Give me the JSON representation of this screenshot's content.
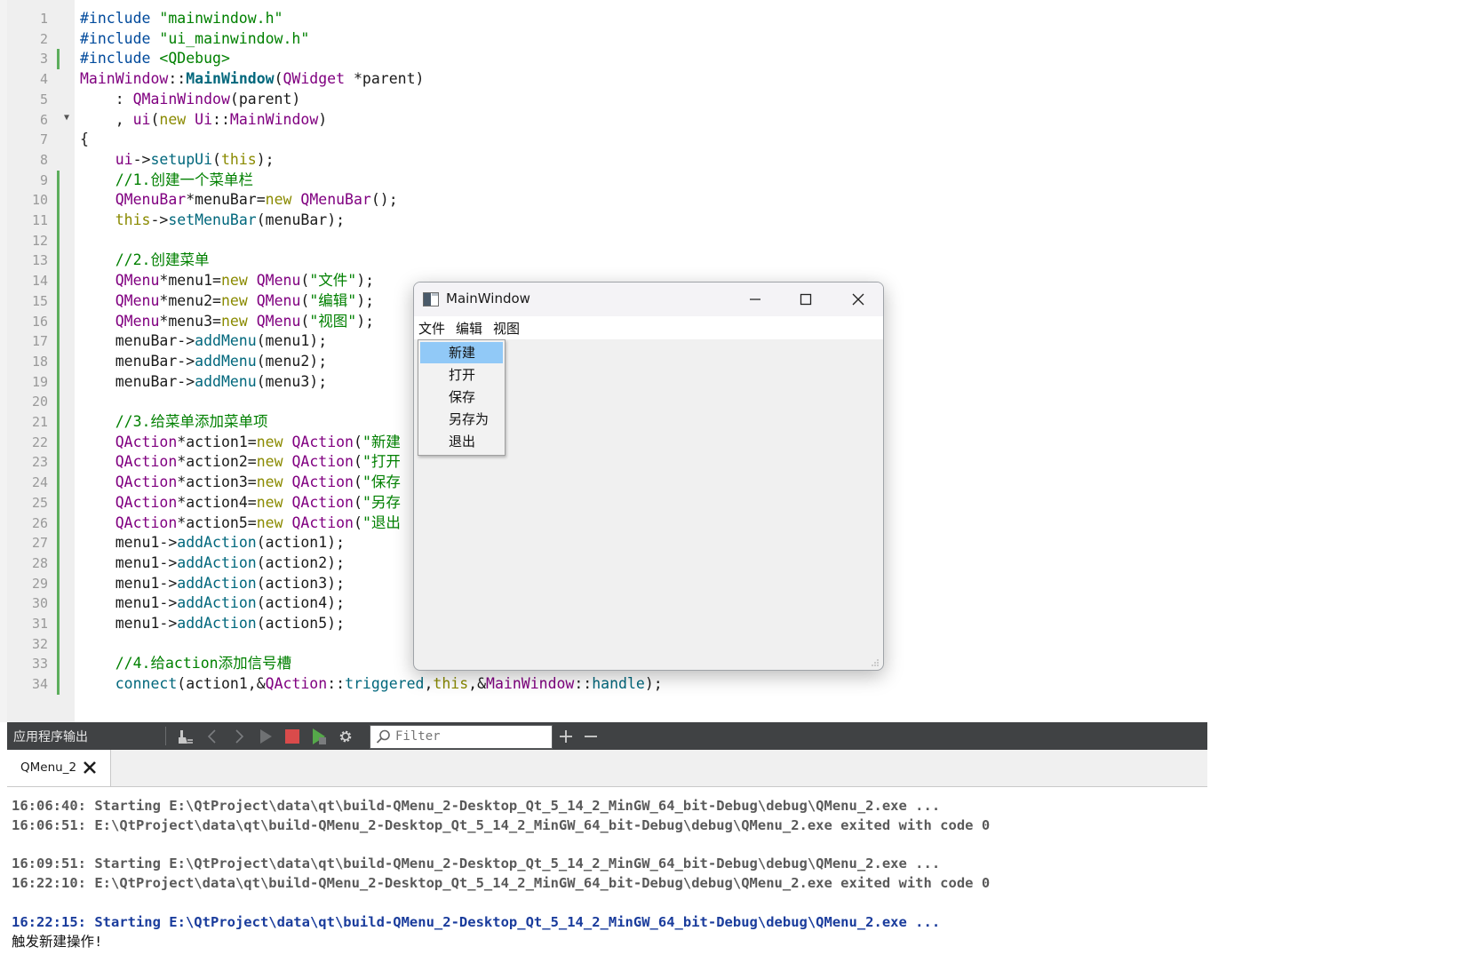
{
  "editor": {
    "line_numbers": [
      "1",
      "2",
      "3",
      "4",
      "5",
      "6",
      "7",
      "8",
      "9",
      "10",
      "11",
      "12",
      "13",
      "14",
      "15",
      "16",
      "17",
      "18",
      "19",
      "20",
      "21",
      "22",
      "23",
      "24",
      "25",
      "26",
      "27",
      "28",
      "29",
      "30",
      "31",
      "32",
      "33",
      "34"
    ],
    "lines": [
      [
        {
          "c": "pp",
          "t": "#include "
        },
        {
          "c": "str",
          "t": "\"mainwindow.h\""
        }
      ],
      [
        {
          "c": "pp",
          "t": "#include "
        },
        {
          "c": "str",
          "t": "\"ui_mainwindow.h\""
        }
      ],
      [
        {
          "c": "pp",
          "t": "#include "
        },
        {
          "c": "str",
          "t": "<QDebug>"
        }
      ],
      [
        {
          "c": "ty",
          "t": "MainWindow"
        },
        {
          "c": "pl",
          "t": "::"
        },
        {
          "c": "fnb",
          "t": "MainWindow"
        },
        {
          "c": "pl",
          "t": "("
        },
        {
          "c": "ty",
          "t": "QWidget"
        },
        {
          "c": "pl",
          "t": " *parent)"
        }
      ],
      [
        {
          "c": "pl",
          "t": "    : "
        },
        {
          "c": "ty",
          "t": "QMainWindow"
        },
        {
          "c": "pl",
          "t": "(parent)"
        }
      ],
      [
        {
          "c": "pl",
          "t": "    , "
        },
        {
          "c": "ty",
          "t": "ui"
        },
        {
          "c": "pl",
          "t": "("
        },
        {
          "c": "kw",
          "t": "new"
        },
        {
          "c": "pl",
          "t": " "
        },
        {
          "c": "ty",
          "t": "Ui"
        },
        {
          "c": "pl",
          "t": "::"
        },
        {
          "c": "ty",
          "t": "MainWindow"
        },
        {
          "c": "pl",
          "t": ")"
        }
      ],
      [
        {
          "c": "pl",
          "t": "{"
        }
      ],
      [
        {
          "c": "pl",
          "t": "    "
        },
        {
          "c": "ty",
          "t": "ui"
        },
        {
          "c": "pl",
          "t": "->"
        },
        {
          "c": "fn",
          "t": "setupUi"
        },
        {
          "c": "pl",
          "t": "("
        },
        {
          "c": "kw",
          "t": "this"
        },
        {
          "c": "pl",
          "t": ");"
        }
      ],
      [
        {
          "c": "cm",
          "t": "    //1.创建一个菜单栏"
        }
      ],
      [
        {
          "c": "pl",
          "t": "    "
        },
        {
          "c": "ty",
          "t": "QMenuBar"
        },
        {
          "c": "pl",
          "t": "*menuBar="
        },
        {
          "c": "kw",
          "t": "new"
        },
        {
          "c": "pl",
          "t": " "
        },
        {
          "c": "ty",
          "t": "QMenuBar"
        },
        {
          "c": "pl",
          "t": "();"
        }
      ],
      [
        {
          "c": "pl",
          "t": "    "
        },
        {
          "c": "kw",
          "t": "this"
        },
        {
          "c": "pl",
          "t": "->"
        },
        {
          "c": "fn",
          "t": "setMenuBar"
        },
        {
          "c": "pl",
          "t": "(menuBar);"
        }
      ],
      [],
      [
        {
          "c": "cm",
          "t": "    //2.创建菜单"
        }
      ],
      [
        {
          "c": "pl",
          "t": "    "
        },
        {
          "c": "ty",
          "t": "QMenu"
        },
        {
          "c": "pl",
          "t": "*menu1="
        },
        {
          "c": "kw",
          "t": "new"
        },
        {
          "c": "pl",
          "t": " "
        },
        {
          "c": "ty",
          "t": "QMenu"
        },
        {
          "c": "pl",
          "t": "("
        },
        {
          "c": "str",
          "t": "\"文件\""
        },
        {
          "c": "pl",
          "t": ");"
        }
      ],
      [
        {
          "c": "pl",
          "t": "    "
        },
        {
          "c": "ty",
          "t": "QMenu"
        },
        {
          "c": "pl",
          "t": "*menu2="
        },
        {
          "c": "kw",
          "t": "new"
        },
        {
          "c": "pl",
          "t": " "
        },
        {
          "c": "ty",
          "t": "QMenu"
        },
        {
          "c": "pl",
          "t": "("
        },
        {
          "c": "str",
          "t": "\"编辑\""
        },
        {
          "c": "pl",
          "t": ");"
        }
      ],
      [
        {
          "c": "pl",
          "t": "    "
        },
        {
          "c": "ty",
          "t": "QMenu"
        },
        {
          "c": "pl",
          "t": "*menu3="
        },
        {
          "c": "kw",
          "t": "new"
        },
        {
          "c": "pl",
          "t": " "
        },
        {
          "c": "ty",
          "t": "QMenu"
        },
        {
          "c": "pl",
          "t": "("
        },
        {
          "c": "str",
          "t": "\"视图\""
        },
        {
          "c": "pl",
          "t": ");"
        }
      ],
      [
        {
          "c": "pl",
          "t": "    menuBar->"
        },
        {
          "c": "fn",
          "t": "addMenu"
        },
        {
          "c": "pl",
          "t": "(menu1);"
        }
      ],
      [
        {
          "c": "pl",
          "t": "    menuBar->"
        },
        {
          "c": "fn",
          "t": "addMenu"
        },
        {
          "c": "pl",
          "t": "(menu2);"
        }
      ],
      [
        {
          "c": "pl",
          "t": "    menuBar->"
        },
        {
          "c": "fn",
          "t": "addMenu"
        },
        {
          "c": "pl",
          "t": "(menu3);"
        }
      ],
      [],
      [
        {
          "c": "cm",
          "t": "    //3.给菜单添加菜单项"
        }
      ],
      [
        {
          "c": "pl",
          "t": "    "
        },
        {
          "c": "ty",
          "t": "QAction"
        },
        {
          "c": "pl",
          "t": "*action1="
        },
        {
          "c": "kw",
          "t": "new"
        },
        {
          "c": "pl",
          "t": " "
        },
        {
          "c": "ty",
          "t": "QAction"
        },
        {
          "c": "pl",
          "t": "("
        },
        {
          "c": "str",
          "t": "\"新建"
        }
      ],
      [
        {
          "c": "pl",
          "t": "    "
        },
        {
          "c": "ty",
          "t": "QAction"
        },
        {
          "c": "pl",
          "t": "*action2="
        },
        {
          "c": "kw",
          "t": "new"
        },
        {
          "c": "pl",
          "t": " "
        },
        {
          "c": "ty",
          "t": "QAction"
        },
        {
          "c": "pl",
          "t": "("
        },
        {
          "c": "str",
          "t": "\"打开"
        }
      ],
      [
        {
          "c": "pl",
          "t": "    "
        },
        {
          "c": "ty",
          "t": "QAction"
        },
        {
          "c": "pl",
          "t": "*action3="
        },
        {
          "c": "kw",
          "t": "new"
        },
        {
          "c": "pl",
          "t": " "
        },
        {
          "c": "ty",
          "t": "QAction"
        },
        {
          "c": "pl",
          "t": "("
        },
        {
          "c": "str",
          "t": "\"保存"
        }
      ],
      [
        {
          "c": "pl",
          "t": "    "
        },
        {
          "c": "ty",
          "t": "QAction"
        },
        {
          "c": "pl",
          "t": "*action4="
        },
        {
          "c": "kw",
          "t": "new"
        },
        {
          "c": "pl",
          "t": " "
        },
        {
          "c": "ty",
          "t": "QAction"
        },
        {
          "c": "pl",
          "t": "("
        },
        {
          "c": "str",
          "t": "\"另存"
        }
      ],
      [
        {
          "c": "pl",
          "t": "    "
        },
        {
          "c": "ty",
          "t": "QAction"
        },
        {
          "c": "pl",
          "t": "*action5="
        },
        {
          "c": "kw",
          "t": "new"
        },
        {
          "c": "pl",
          "t": " "
        },
        {
          "c": "ty",
          "t": "QAction"
        },
        {
          "c": "pl",
          "t": "("
        },
        {
          "c": "str",
          "t": "\"退出"
        }
      ],
      [
        {
          "c": "pl",
          "t": "    menu1->"
        },
        {
          "c": "fn",
          "t": "addAction"
        },
        {
          "c": "pl",
          "t": "(action1);"
        }
      ],
      [
        {
          "c": "pl",
          "t": "    menu1->"
        },
        {
          "c": "fn",
          "t": "addAction"
        },
        {
          "c": "pl",
          "t": "(action2);"
        }
      ],
      [
        {
          "c": "pl",
          "t": "    menu1->"
        },
        {
          "c": "fn",
          "t": "addAction"
        },
        {
          "c": "pl",
          "t": "(action3);"
        }
      ],
      [
        {
          "c": "pl",
          "t": "    menu1->"
        },
        {
          "c": "fn",
          "t": "addAction"
        },
        {
          "c": "pl",
          "t": "(action4);"
        }
      ],
      [
        {
          "c": "pl",
          "t": "    menu1->"
        },
        {
          "c": "fn",
          "t": "addAction"
        },
        {
          "c": "pl",
          "t": "(action5);"
        }
      ],
      [],
      [
        {
          "c": "cm",
          "t": "    //4.给action添加信号槽"
        }
      ],
      [
        {
          "c": "pl",
          "t": "    "
        },
        {
          "c": "fn",
          "t": "connect"
        },
        {
          "c": "pl",
          "t": "(action1,&"
        },
        {
          "c": "ty",
          "t": "QAction"
        },
        {
          "c": "pl",
          "t": "::"
        },
        {
          "c": "fn",
          "t": "triggered"
        },
        {
          "c": "pl",
          "t": ","
        },
        {
          "c": "kw",
          "t": "this"
        },
        {
          "c": "pl",
          "t": ",&"
        },
        {
          "c": "ty",
          "t": "MainWindow"
        },
        {
          "c": "pl",
          "t": "::"
        },
        {
          "c": "fn",
          "t": "handle"
        },
        {
          "c": "pl",
          "t": ");"
        }
      ]
    ]
  },
  "qt_window": {
    "title": "MainWindow",
    "menubar": [
      "文件",
      "编辑",
      "视图"
    ],
    "dropdown_items": [
      "新建",
      "打开",
      "保存",
      "另存为",
      "退出"
    ],
    "selected_index": 0,
    "icons": {
      "minimize": "minimize-icon",
      "maximize": "maximize-icon",
      "close": "close-icon"
    }
  },
  "output": {
    "title": "应用程序输出",
    "filter_placeholder": "Filter",
    "tab_label": "QMenu_2",
    "lines": [
      {
        "text": "16:06:40: Starting E:\\QtProject\\data\\qt\\build-QMenu_2-Desktop_Qt_5_14_2_MinGW_64_bit-Debug\\debug\\QMenu_2.exe ...",
        "style": "old"
      },
      {
        "text": "16:06:51: E:\\QtProject\\data\\qt\\build-QMenu_2-Desktop_Qt_5_14_2_MinGW_64_bit-Debug\\debug\\QMenu_2.exe exited with code 0",
        "style": "old"
      },
      {
        "text": "",
        "style": "blank"
      },
      {
        "text": "16:09:51: Starting E:\\QtProject\\data\\qt\\build-QMenu_2-Desktop_Qt_5_14_2_MinGW_64_bit-Debug\\debug\\QMenu_2.exe ...",
        "style": "old"
      },
      {
        "text": "16:22:10: E:\\QtProject\\data\\qt\\build-QMenu_2-Desktop_Qt_5_14_2_MinGW_64_bit-Debug\\debug\\QMenu_2.exe exited with code 0",
        "style": "old"
      },
      {
        "text": "",
        "style": "blank"
      },
      {
        "text": "16:22:15: Starting E:\\QtProject\\data\\qt\\build-QMenu_2-Desktop_Qt_5_14_2_MinGW_64_bit-Debug\\debug\\QMenu_2.exe ...",
        "style": "active"
      },
      {
        "text": "触发新建操作!",
        "style": "plain"
      }
    ]
  },
  "colors": {
    "selection": "#91c9f7",
    "toolbar": "#404244",
    "change_marker": "#5dae5d",
    "active_log": "#1a3c9c"
  }
}
